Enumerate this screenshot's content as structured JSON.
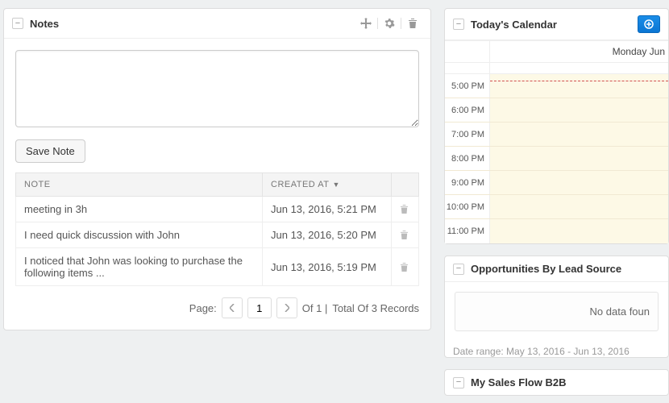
{
  "notes": {
    "title": "Notes",
    "save_label": "Save Note",
    "columns": {
      "note": "NOTE",
      "created_at": "CREATED AT"
    },
    "rows": [
      {
        "text": "meeting in 3h",
        "created_at": "Jun 13, 2016, 5:21 PM"
      },
      {
        "text": "I need quick discussion with John",
        "created_at": "Jun 13, 2016, 5:20 PM"
      },
      {
        "text": "I noticed that John was looking to purchase the following items ...",
        "created_at": "Jun 13, 2016, 5:19 PM"
      }
    ],
    "pagination": {
      "page_label": "Page:",
      "current": "1",
      "of_label": "Of 1 |",
      "total_label": "Total Of 3 Records"
    }
  },
  "calendar": {
    "title": "Today's Calendar",
    "day_label": "Monday Jun",
    "times": [
      "5:00 PM",
      "6:00 PM",
      "7:00 PM",
      "8:00 PM",
      "9:00 PM",
      "10:00 PM",
      "11:00 PM"
    ]
  },
  "opportunities": {
    "title": "Opportunities By Lead Source",
    "empty_text": "No data foun",
    "date_range": "Date range: May 13, 2016 - Jun 13, 2016"
  },
  "sales_flow": {
    "title": "My Sales Flow B2B"
  }
}
